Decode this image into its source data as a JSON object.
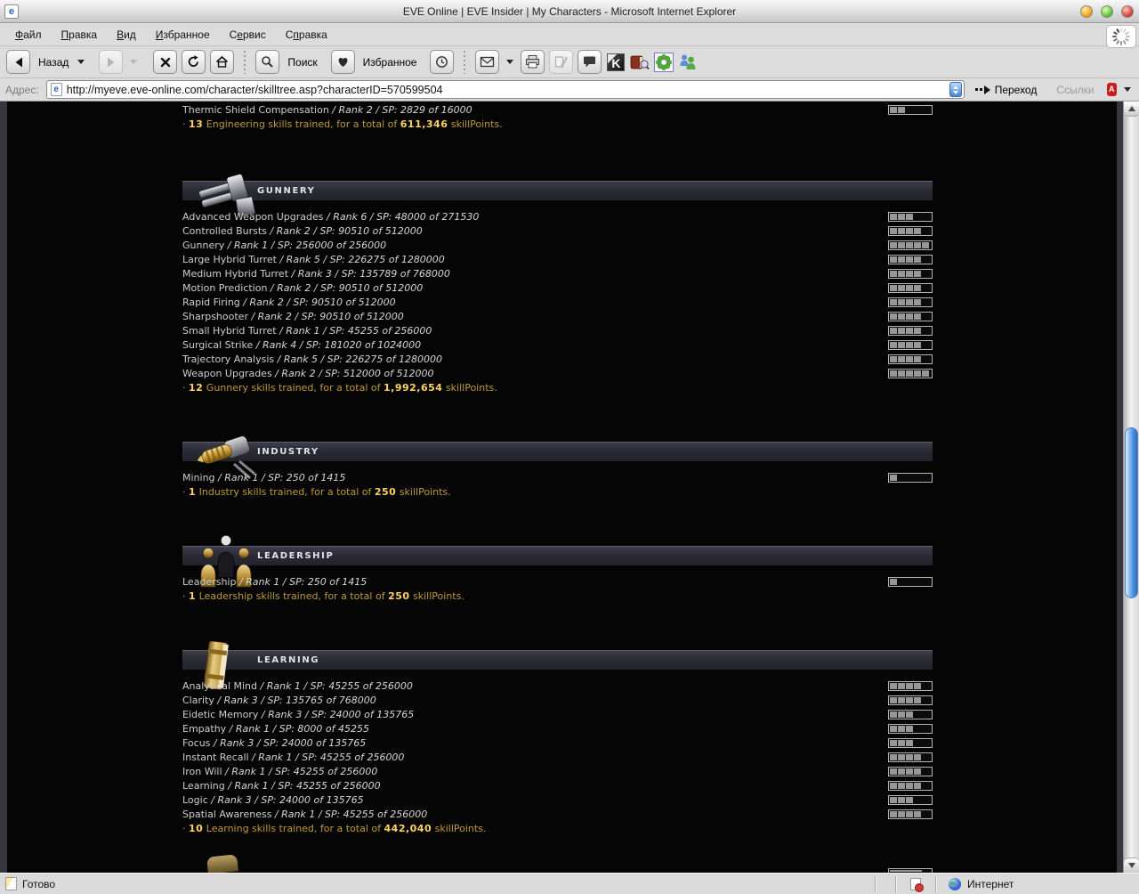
{
  "window": {
    "title": "EVE Online | EVE Insider | My Characters - Microsoft Internet Explorer",
    "buttons": [
      "minimize",
      "maximize",
      "close"
    ]
  },
  "menu": {
    "items": [
      {
        "name": "file",
        "label": "Файл",
        "u": 0
      },
      {
        "name": "edit",
        "label": "Правка",
        "u": 0
      },
      {
        "name": "view",
        "label": "Вид",
        "u": 0
      },
      {
        "name": "favorites",
        "label": "Избранное",
        "u": 0
      },
      {
        "name": "tools",
        "label": "Сервис",
        "u": 1
      },
      {
        "name": "help",
        "label": "Справка",
        "u": 1
      }
    ]
  },
  "toolbar": {
    "back_label": "Назад",
    "search_label": "Поиск",
    "favorites_label": "Избранное",
    "icons": [
      "back-icon",
      "forward-icon",
      "stop-icon",
      "refresh-icon",
      "home-icon",
      "search-icon",
      "favorites-heart-icon",
      "history-clock-icon",
      "mail-icon",
      "print-icon",
      "edit-icon",
      "discuss-icon",
      "kaspersky-icon",
      "dictionary-book-icon",
      "icq-flower-icon",
      "messenger-people-icon"
    ]
  },
  "addressbar": {
    "label": "Адрес:",
    "url": "http://myeve.eve-online.com/character/skilltree.asp?characterID=570599504",
    "go_label": "Переход",
    "links_label": "Ссылки"
  },
  "statusbar": {
    "ready": "Готово",
    "zone": "Интернет"
  },
  "page": {
    "sections": [
      {
        "title": "",
        "icon": "",
        "skills": [
          {
            "name": "Thermic Shield Compensation",
            "detail": "Rank 2 / SP: 2829 of 16000",
            "level": 2
          }
        ],
        "summary": {
          "count": "13",
          "text": "Engineering skills trained, for a total of",
          "total": "611,346",
          "suffix": "skillPoints."
        }
      },
      {
        "title": "GUNNERY",
        "icon": "turret-icon",
        "skills": [
          {
            "name": "Advanced Weapon Upgrades",
            "detail": "Rank 6 / SP: 48000 of 271530",
            "level": 3
          },
          {
            "name": "Controlled Bursts",
            "detail": "Rank 2 / SP: 90510 of 512000",
            "level": 4
          },
          {
            "name": "Gunnery",
            "detail": "Rank 1 / SP: 256000 of 256000",
            "level": 5
          },
          {
            "name": "Large Hybrid Turret",
            "detail": "Rank 5 / SP: 226275 of 1280000",
            "level": 4
          },
          {
            "name": "Medium Hybrid Turret",
            "detail": "Rank 3 / SP: 135789 of 768000",
            "level": 4
          },
          {
            "name": "Motion Prediction",
            "detail": "Rank 2 / SP: 90510 of 512000",
            "level": 4
          },
          {
            "name": "Rapid Firing",
            "detail": "Rank 2 / SP: 90510 of 512000",
            "level": 4
          },
          {
            "name": "Sharpshooter",
            "detail": "Rank 2 / SP: 90510 of 512000",
            "level": 4
          },
          {
            "name": "Small Hybrid Turret",
            "detail": "Rank 1 / SP: 45255 of 256000",
            "level": 4
          },
          {
            "name": "Surgical Strike",
            "detail": "Rank 4 / SP: 181020 of 1024000",
            "level": 4
          },
          {
            "name": "Trajectory Analysis",
            "detail": "Rank 5 / SP: 226275 of 1280000",
            "level": 4
          },
          {
            "name": "Weapon Upgrades",
            "detail": "Rank 2 / SP: 512000 of 512000",
            "level": 5
          }
        ],
        "summary": {
          "count": "12",
          "text": "Gunnery skills trained, for a total of",
          "total": "1,992,654",
          "suffix": "skillPoints."
        }
      },
      {
        "title": "INDUSTRY",
        "icon": "mining-laser-icon",
        "skills": [
          {
            "name": "Mining",
            "detail": "Rank 1 / SP: 250 of 1415",
            "level": 1
          }
        ],
        "summary": {
          "count": "1",
          "text": "Industry skills trained, for a total of",
          "total": "250",
          "suffix": "skillPoints."
        }
      },
      {
        "title": "LEADERSHIP",
        "icon": "leadership-figures-icon",
        "skills": [
          {
            "name": "Leadership",
            "detail": "Rank 1 / SP: 250 of 1415",
            "level": 1
          }
        ],
        "summary": {
          "count": "1",
          "text": "Leadership skills trained, for a total of",
          "total": "250",
          "suffix": "skillPoints."
        }
      },
      {
        "title": "LEARNING",
        "icon": "book-icon",
        "skills": [
          {
            "name": "Analytical Mind",
            "detail": "Rank 1 / SP: 45255 of 256000",
            "level": 4
          },
          {
            "name": "Clarity",
            "detail": "Rank 3 / SP: 135765 of 768000",
            "level": 4
          },
          {
            "name": "Eidetic Memory",
            "detail": "Rank 3 / SP: 24000 of 135765",
            "level": 3
          },
          {
            "name": "Empathy",
            "detail": "Rank 1 / SP: 8000 of 45255",
            "level": 3
          },
          {
            "name": "Focus",
            "detail": "Rank 3 / SP: 24000 of 135765",
            "level": 3
          },
          {
            "name": "Instant Recall",
            "detail": "Rank 1 / SP: 45255 of 256000",
            "level": 4
          },
          {
            "name": "Iron Will",
            "detail": "Rank 1 / SP: 45255 of 256000",
            "level": 4
          },
          {
            "name": "Learning",
            "detail": "Rank 1 / SP: 45255 of 256000",
            "level": 4
          },
          {
            "name": "Logic",
            "detail": "Rank 3 / SP: 24000 of 135765",
            "level": 3
          },
          {
            "name": "Spatial Awareness",
            "detail": "Rank 1 / SP: 45255 of 256000",
            "level": 4
          }
        ],
        "summary": {
          "count": "10",
          "text": "Learning skills trained, for a total of",
          "total": "442,040",
          "suffix": "skillPoints."
        }
      }
    ]
  }
}
